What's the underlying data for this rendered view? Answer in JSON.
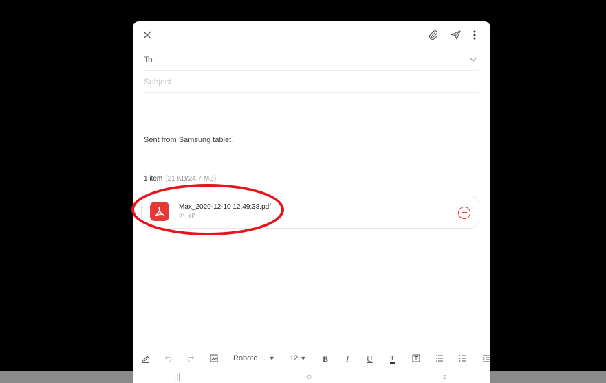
{
  "header": {
    "close_icon": "close-icon",
    "attach_icon": "paperclip-icon",
    "send_icon": "send-icon",
    "more_icon": "more-vert-icon"
  },
  "fields": {
    "to_label": "To",
    "subject_placeholder": "Subject"
  },
  "body": {
    "signature": "Sent from Samsung tablet."
  },
  "attachments": {
    "summary_count": "1 item",
    "summary_size": "(21 KB/24.7 MB)",
    "items": [
      {
        "name": "Max_2020-12-10 12:49:38.pdf",
        "size": "21 KB"
      }
    ]
  },
  "toolbar": {
    "font_name": "Roboto ...",
    "font_size": "12",
    "bold": "B",
    "italic": "I",
    "underline": "U",
    "text_color": "T"
  },
  "navbar": {
    "recents": "|||",
    "home": "○",
    "back": "‹"
  },
  "colors": {
    "accent": "#e53935",
    "highlight_ring": "#e8141c"
  }
}
